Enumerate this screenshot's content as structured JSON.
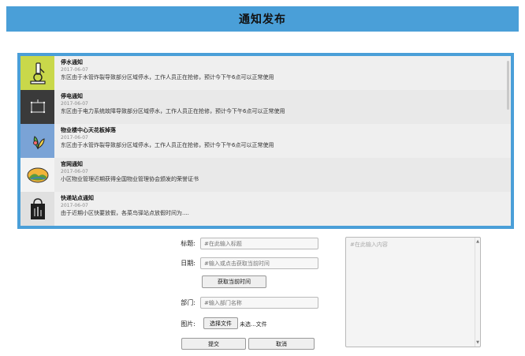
{
  "header": {
    "title": "通知发布"
  },
  "notices": [
    {
      "title": "停水通知",
      "date": "2017-06-07",
      "desc": "东区由于水管炸裂导致部分区域停水，工作人员正在抢修，预计今下午6点可以正常使用",
      "icon": "microscope-icon",
      "thumb_color": "#c9d84a"
    },
    {
      "title": "停电通知",
      "date": "2017-06-07",
      "desc": "东区由于电力系统故障导致部分区域停水，工作人员正在抢修，预计今下午6点可以正常使用",
      "icon": "frame-icon",
      "thumb_color": "#3a3a3a"
    },
    {
      "title": "物业楼中心天花板掉落",
      "date": "2017-06-07",
      "desc": "东区由于水管炸裂导致部分区域停水，工作人员正在抢修，预计今下午6点可以正常使用",
      "icon": "plant-icon",
      "thumb_color": "#7aa3d6"
    },
    {
      "title": "官网通知",
      "date": "2017-06-07",
      "desc": "小区物业管理近期获得全国物业管理协会颁发的荣誉证书",
      "icon": "landscape-icon",
      "thumb_color": "#f3f3f3"
    },
    {
      "title": "快递站点通知",
      "date": "2017-06-07",
      "desc": "由于近期小区快要放假，各菜鸟驿站点放假时间为....",
      "icon": "tote-bag-icon",
      "thumb_color": "#e0e0e0"
    }
  ],
  "form": {
    "title_label": "标题:",
    "title_placeholder": "#在此输入标题",
    "date_label": "日期:",
    "date_placeholder": "#输入或点击获取当前时间",
    "get_time_button": "获取当前时间",
    "dept_label": "部门:",
    "dept_placeholder": "#输入部门名称",
    "image_label": "图片:",
    "choose_file_button": "选择文件",
    "file_status": "未选...文件",
    "submit_button": "提交",
    "cancel_button": "取消",
    "content_placeholder": "#在此输入内容"
  }
}
